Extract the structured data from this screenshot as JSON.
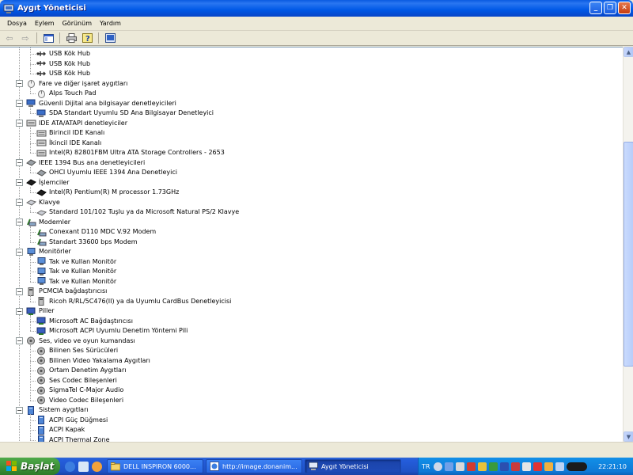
{
  "window": {
    "title": "Aygıt Yöneticisi",
    "controls": {
      "minimize": "_",
      "maximize": "❐",
      "close": "✕"
    }
  },
  "menu": [
    "Dosya",
    "Eylem",
    "Görünüm",
    "Yardım"
  ],
  "toolbar": {
    "buttons": [
      "back-arrow",
      "forward-arrow",
      "show-hide-tree",
      "print",
      "help",
      "properties"
    ]
  },
  "tree": [
    {
      "level": 1,
      "label": "USB Kök Hub",
      "icon": "usb-icon"
    },
    {
      "level": 1,
      "label": "USB Kök Hub",
      "icon": "usb-icon"
    },
    {
      "level": 1,
      "label": "USB Kök Hub",
      "icon": "usb-icon"
    },
    {
      "level": 0,
      "label": "Fare ve diğer işaret aygıtları",
      "icon": "mouse-icon"
    },
    {
      "level": 1,
      "label": "Alps Touch Pad",
      "icon": "mouse-icon"
    },
    {
      "level": 0,
      "label": "Güvenli Dijital ana bilgisayar denetleyicileri",
      "icon": "sd-host-icon"
    },
    {
      "level": 1,
      "label": "SDA Standart Uyumlu SD Ana Bilgisayar Denetleyici",
      "icon": "sd-host-icon"
    },
    {
      "level": 0,
      "label": "IDE ATA/ATAPI denetleyiciler",
      "icon": "ide-icon"
    },
    {
      "level": 1,
      "label": "Birincil IDE Kanalı",
      "icon": "ide-icon"
    },
    {
      "level": 1,
      "label": "İkincil IDE Kanalı",
      "icon": "ide-icon"
    },
    {
      "level": 1,
      "label": "Intel(R) 82801FBM Ultra ATA Storage Controllers - 2653",
      "icon": "ide-icon"
    },
    {
      "level": 0,
      "label": "IEEE 1394 Bus ana denetleyicileri",
      "icon": "firewire-icon"
    },
    {
      "level": 1,
      "label": "OHCI Uyumlu IEEE 1394 Ana Denetleyici",
      "icon": "firewire-icon"
    },
    {
      "level": 0,
      "label": "İşlemciler",
      "icon": "processor-icon"
    },
    {
      "level": 1,
      "label": "Intel(R) Pentium(R) M processor 1.73GHz",
      "icon": "processor-icon"
    },
    {
      "level": 0,
      "label": "Klavye",
      "icon": "keyboard-icon"
    },
    {
      "level": 1,
      "label": "Standard 101/102 Tuşlu ya da Microsoft Natural PS/2 Klavye",
      "icon": "keyboard-icon"
    },
    {
      "level": 0,
      "label": "Modemler",
      "icon": "modem-icon"
    },
    {
      "level": 1,
      "label": "Conexant D110 MDC V.92 Modem",
      "icon": "modem-icon"
    },
    {
      "level": 1,
      "label": "Standart 33600 bps Modem",
      "icon": "modem-icon"
    },
    {
      "level": 0,
      "label": "Monitörler",
      "icon": "monitor-icon"
    },
    {
      "level": 1,
      "label": "Tak ve Kullan Monitör",
      "icon": "monitor-icon"
    },
    {
      "level": 1,
      "label": "Tak ve Kullan Monitör",
      "icon": "monitor-icon"
    },
    {
      "level": 1,
      "label": "Tak ve Kullan Monitör",
      "icon": "monitor-icon"
    },
    {
      "level": 0,
      "label": "PCMCIA bağdaştırıcısı",
      "icon": "pcmcia-icon"
    },
    {
      "level": 1,
      "label": "Ricoh R/RL/5C476(II) ya da Uyumlu CardBus Denetleyicisi",
      "icon": "pcmcia-icon"
    },
    {
      "level": 0,
      "label": "Piller",
      "icon": "battery-icon"
    },
    {
      "level": 1,
      "label": "Microsoft AC Bağdaştırıcısı",
      "icon": "battery-icon"
    },
    {
      "level": 1,
      "label": "Microsoft ACPI Uyumlu Denetim Yöntemi Pili",
      "icon": "battery-icon"
    },
    {
      "level": 0,
      "label": "Ses, video ve oyun kumandası",
      "icon": "sound-icon"
    },
    {
      "level": 1,
      "label": "Bilinen Ses Sürücüleri",
      "icon": "sound-icon"
    },
    {
      "level": 1,
      "label": "Bilinen Video Yakalama Aygıtları",
      "icon": "sound-icon"
    },
    {
      "level": 1,
      "label": "Ortam Denetim Aygıtları",
      "icon": "sound-icon"
    },
    {
      "level": 1,
      "label": "Ses Codec Bileşenleri",
      "icon": "sound-icon"
    },
    {
      "level": 1,
      "label": "SigmaTel C-Major Audio",
      "icon": "sound-icon"
    },
    {
      "level": 1,
      "label": "Video Codec Bileşenleri",
      "icon": "sound-icon"
    },
    {
      "level": 0,
      "label": "Sistem aygıtları",
      "icon": "system-device-icon"
    },
    {
      "level": 1,
      "label": "ACPI Güç Düğmesi",
      "icon": "system-device-icon"
    },
    {
      "level": 1,
      "label": "ACPI Kapak",
      "icon": "system-device-icon"
    },
    {
      "level": 1,
      "label": "ACPI Thermal Zone",
      "icon": "system-device-icon"
    }
  ],
  "taskbar": {
    "start_label": "Başlat",
    "tasks": [
      {
        "label": "DELL INSPIRON 6000...",
        "icon": "folder-icon",
        "active": false
      },
      {
        "label": "http://image.donanim...",
        "icon": "browser-icon",
        "active": false
      },
      {
        "label": "Aygıt Yöneticisi",
        "icon": "device-manager-icon",
        "active": true
      }
    ],
    "tray": {
      "language": "TR",
      "clock": "22:21:10"
    }
  },
  "colors": {
    "titlebar": "#0058e6",
    "taskbar": "#245ddb",
    "start": "#3c8f36",
    "tray": "#0f79d6",
    "pane": "#ffffff"
  }
}
